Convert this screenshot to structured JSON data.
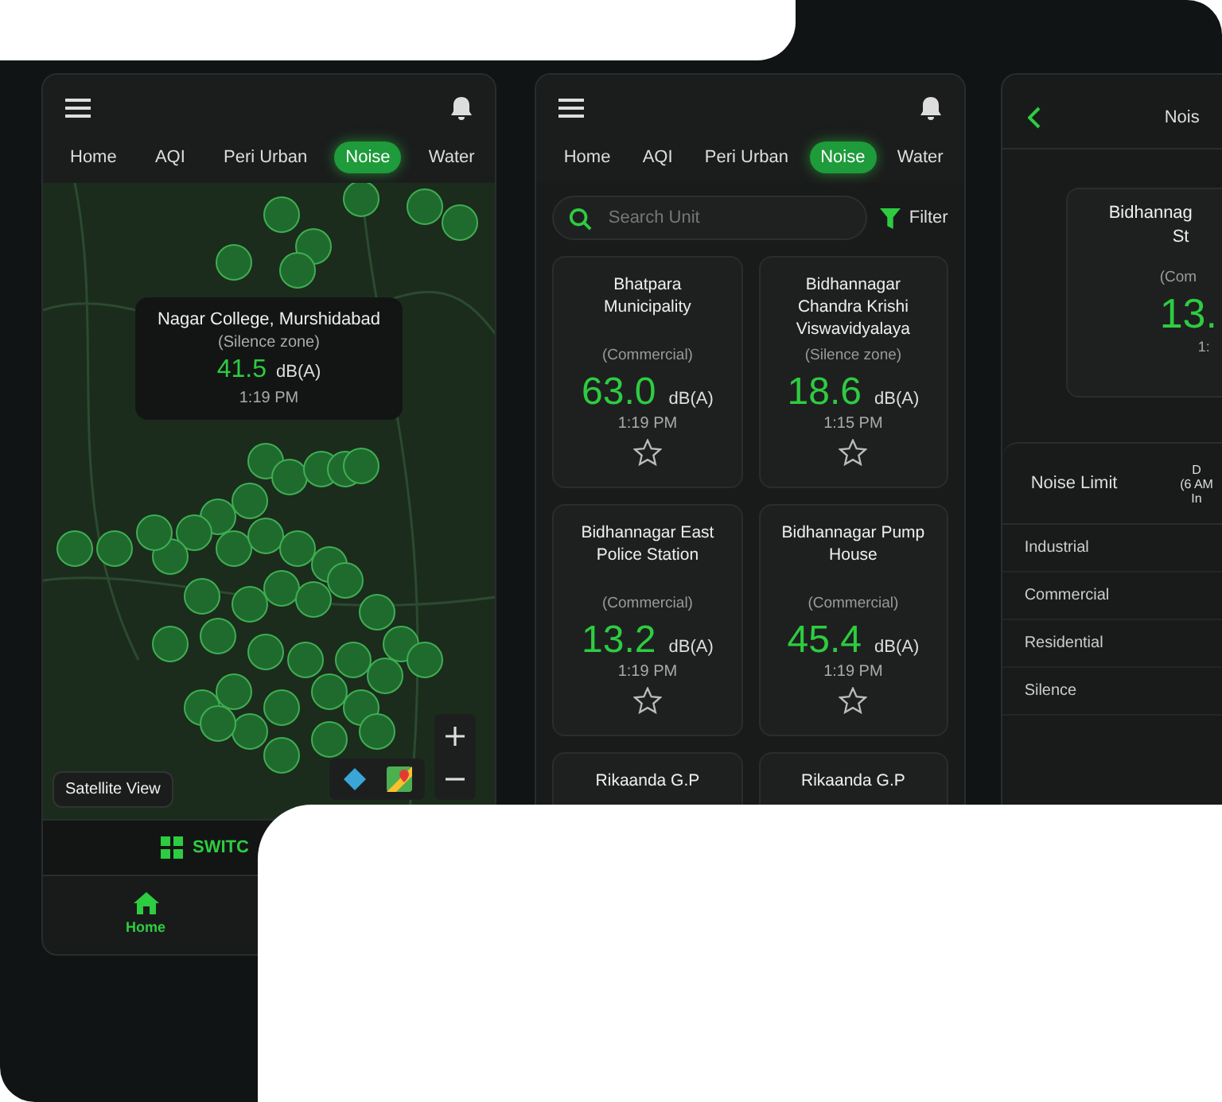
{
  "map_screen": {
    "tabs": [
      {
        "label": "Home",
        "selected": false
      },
      {
        "label": "AQI",
        "selected": false
      },
      {
        "label": "Peri Urban",
        "selected": false
      },
      {
        "label": "Noise",
        "selected": true
      },
      {
        "label": "Water",
        "selected": false
      }
    ],
    "popup": {
      "name": "Nagar College, Murshidabad",
      "zone": "(Silence zone)",
      "value": "41.5",
      "unit": "dB(A)",
      "time": "1:19 PM"
    },
    "satellite_button": "Satellite View",
    "switch_label": "SWITC",
    "nav": [
      {
        "label": "Home",
        "selected": true
      }
    ]
  },
  "list_screen": {
    "tabs": [
      {
        "label": "Home",
        "selected": false
      },
      {
        "label": "AQI",
        "selected": false
      },
      {
        "label": "Peri Urban",
        "selected": false
      },
      {
        "label": "Noise",
        "selected": true
      },
      {
        "label": "Water",
        "selected": false
      }
    ],
    "search": {
      "placeholder": "Search Unit"
    },
    "filter": "Filter",
    "cards": [
      {
        "name": "Bhatpara Municipality",
        "zone": "(Commercial)",
        "value": "63.0",
        "unit": "dB(A)",
        "time": "1:19 PM",
        "favorite": false
      },
      {
        "name": "Bidhannagar Chandra Krishi Viswavidyalaya",
        "zone": "(Silence zone)",
        "value": "18.6",
        "unit": "dB(A)",
        "time": "1:15 PM",
        "favorite": false
      },
      {
        "name": "Bidhannagar East Police Station",
        "zone": "(Commercial)",
        "value": "13.2",
        "unit": "dB(A)",
        "time": "1:19 PM",
        "favorite": false
      },
      {
        "name": "Bidhannagar Pump House",
        "zone": "(Commercial)",
        "value": "45.4",
        "unit": "dB(A)",
        "time": "1:19 PM",
        "favorite": false
      },
      {
        "name": "Rikaanda G.P"
      },
      {
        "name": "Rikaanda G.P"
      }
    ]
  },
  "detail_screen": {
    "title": "Nois",
    "card": {
      "name_lines": [
        "Bidhannag",
        "St"
      ],
      "zone": "(Com",
      "value": "13.",
      "time": "1:"
    },
    "limits": {
      "header": "Noise Limit",
      "column_2_lines": [
        "D",
        "(6 AM",
        "In"
      ],
      "rows": [
        "Industrial",
        "Commercial",
        "Residential",
        "Silence"
      ]
    }
  }
}
